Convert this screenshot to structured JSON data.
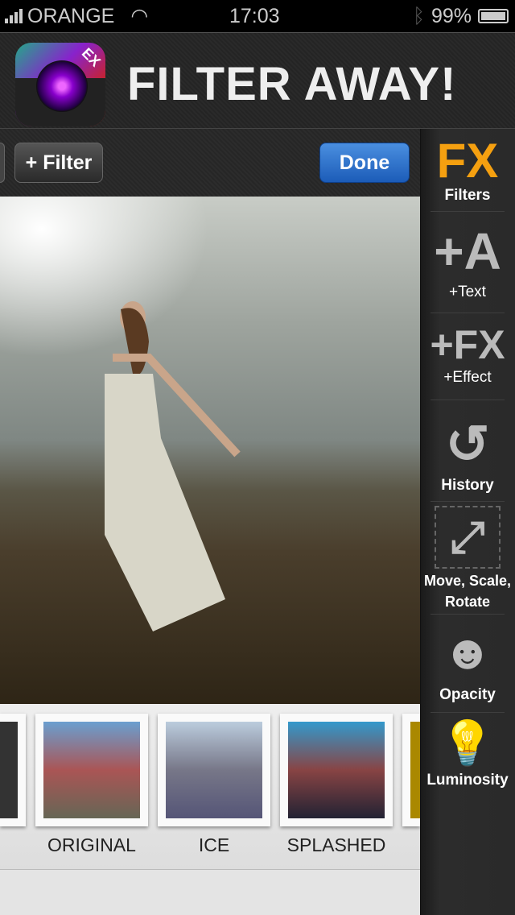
{
  "status": {
    "carrier": "ORANGE",
    "time": "17:03",
    "battery": "99%",
    "battery_level": 0.99
  },
  "header": {
    "title": "FILTER AWAY!",
    "app_icon_badge": "EX"
  },
  "toolbar": {
    "filter_label": "+ Filter",
    "done_label": "Done"
  },
  "filters": [
    {
      "label": "ORIGINAL"
    },
    {
      "label": "ICE"
    },
    {
      "label": "SPLASHED"
    }
  ],
  "sidebar": {
    "items": [
      {
        "icon": "FX",
        "label": "Filters"
      },
      {
        "icon": "+A",
        "label": "+Text"
      },
      {
        "icon": "+FX",
        "label": "+Effect"
      },
      {
        "icon": "history-clock-icon",
        "label": "History"
      },
      {
        "icon": "move-arrows-icon",
        "label": "Move, Scale, Rotate"
      },
      {
        "icon": "person-fx-icon",
        "label": "Opacity"
      },
      {
        "icon": "lightbulb-icon",
        "label": "Luminosity"
      }
    ]
  },
  "colors": {
    "fx_accent": "#f5a010",
    "done_button": "#2a6fcf"
  }
}
